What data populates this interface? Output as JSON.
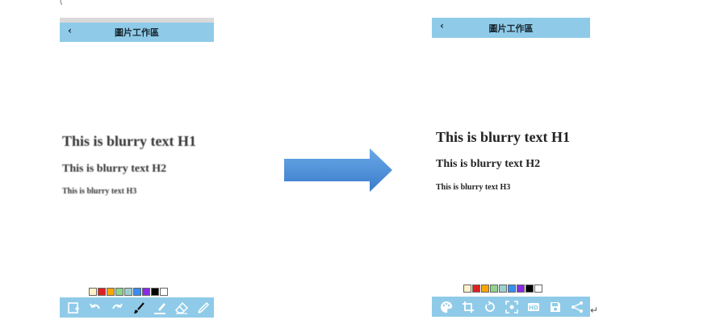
{
  "before_screen": {
    "title": "圖片工作區",
    "back_label": "‹",
    "texts": {
      "h1": "This is blurry text H1",
      "h2": "This is blurry text H2",
      "h3": "This is blurry text H3"
    },
    "palette": [
      "#fff1c9",
      "#e02020",
      "#ffa500",
      "#8fd18f",
      "#9ecfcf",
      "#3a8cf0",
      "#8a2be2",
      "#000000",
      "#ffffff"
    ],
    "tools": [
      "image-import-icon",
      "undo-icon",
      "redo-icon",
      "brush-icon",
      "highlighter-icon",
      "eraser-icon",
      "eyedropper-icon"
    ]
  },
  "after_screen": {
    "title": "圖片工作區",
    "back_label": "‹",
    "texts": {
      "h1": "This is blurry text H1",
      "h2": "This is blurry text H2",
      "h3": "This is blurry text H3"
    },
    "palette": [
      "#fff1c9",
      "#e02020",
      "#ffa500",
      "#8fd18f",
      "#9ecfcf",
      "#3a8cf0",
      "#8a2be2",
      "#000000",
      "#ffffff"
    ],
    "tools": [
      "palette-icon",
      "crop-icon",
      "rotate-icon",
      "focus-icon",
      "hd-icon",
      "save-icon",
      "share-icon"
    ],
    "hd_label": "HD"
  },
  "arrow_color": "#4a8fd8",
  "return_mark": "↵",
  "corner_mark": "("
}
